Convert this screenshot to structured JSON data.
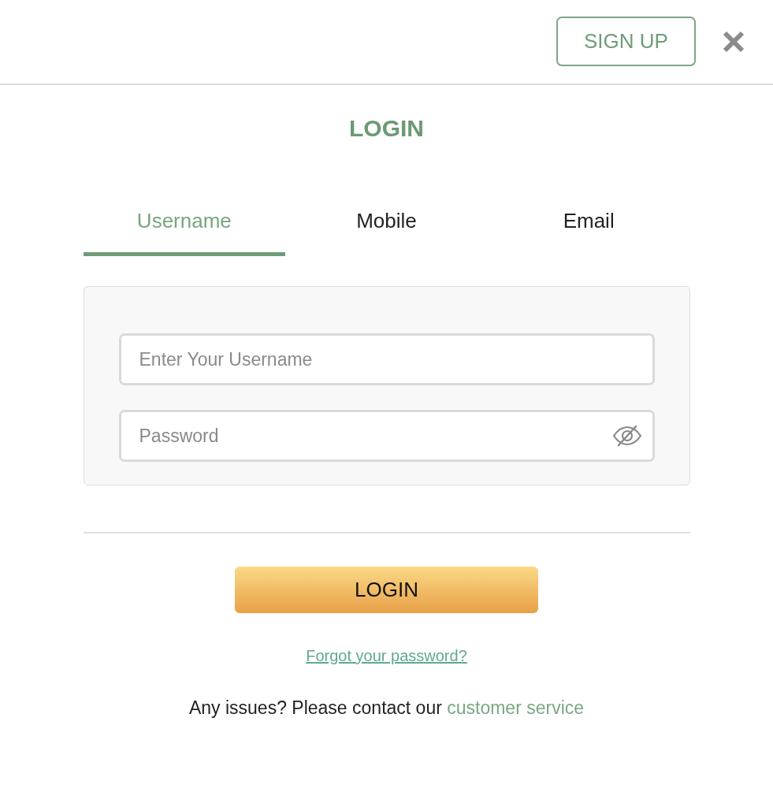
{
  "header": {
    "signup_button": "SIGN UP"
  },
  "title": "LOGIN",
  "tabs": [
    {
      "label": "Username",
      "selected": true
    },
    {
      "label": "Mobile",
      "selected": false
    },
    {
      "label": "Email",
      "selected": false
    }
  ],
  "form": {
    "fields": [
      {
        "kind": "text",
        "placeholder": "Enter Your Username"
      },
      {
        "kind": "password",
        "placeholder": "Password"
      }
    ]
  },
  "login_button": "LOGIN",
  "forgot_link": "Forgot your password?",
  "contact": {
    "text": "Any issues? Please contact our",
    "link": "customer service"
  }
}
